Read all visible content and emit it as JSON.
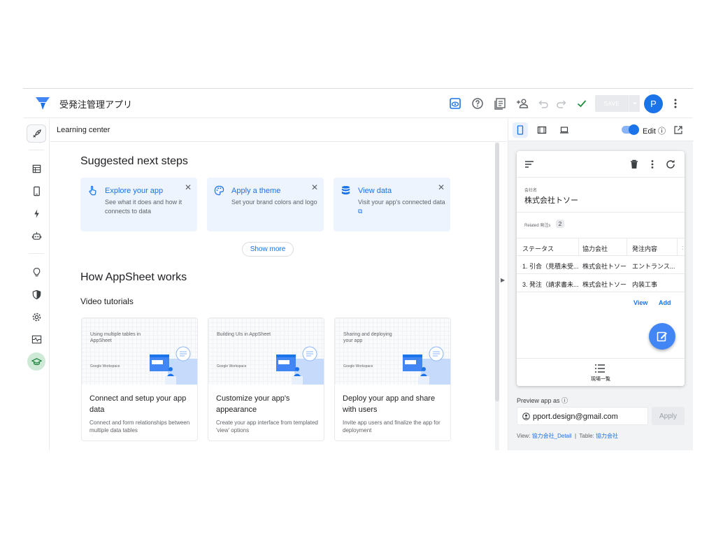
{
  "header": {
    "app_title": "受発注管理アプリ",
    "save_label": "SAVE",
    "avatar_initial": "P",
    "brand_color": "#1a73e8"
  },
  "rail": {
    "items": [
      "rocket-icon",
      "data-icon",
      "phone-icon",
      "automation-icon",
      "bot-icon",
      "lightbulb-icon",
      "shield-icon",
      "settings-icon",
      "monitor-icon",
      "learning-icon"
    ]
  },
  "learning_center": {
    "title": "Learning center",
    "suggested_heading": "Suggested next steps",
    "steps": [
      {
        "title": "Explore your app",
        "desc": "See what it does and how it connects to data",
        "icon": "hand-pointer-icon"
      },
      {
        "title": "Apply a theme",
        "desc": "Set your brand colors and logo",
        "icon": "palette-icon"
      },
      {
        "title": "View data",
        "desc": "Visit your app's connected data",
        "icon": "database-icon"
      }
    ],
    "show_more": "Show more",
    "how_heading": "How AppSheet works",
    "video_heading": "Video tutorials",
    "videos": [
      {
        "thumb_title": "Using multiple tables in AppSheet",
        "brand": "Google Workspace",
        "title": "Connect and setup your app data",
        "desc": "Connect and form relationships between multiple data tables"
      },
      {
        "thumb_title": "Building UIs in AppSheet",
        "brand": "Google Workspace",
        "title": "Customize your app's appearance",
        "desc": "Create your app interface from templated 'view' options"
      },
      {
        "thumb_title": "Sharing and deploying your app",
        "brand": "Google Workspace",
        "title": "Deploy your app and share with users",
        "desc": "Invite app users and finalize the app for deployment"
      }
    ]
  },
  "preview": {
    "edit_label": "Edit",
    "field_label": "会社名",
    "field_value": "株式会社トソー",
    "related_label": "Related 発注s",
    "related_count": "2",
    "table": {
      "headers": [
        "ステータス",
        "協力会社",
        "発注内容"
      ],
      "rows": [
        [
          "1. 引合（見積未受...",
          "株式会社トソー",
          "エントランス..."
        ],
        [
          "3. 発注（請求書未...",
          "株式会社トソー",
          "内装工事"
        ]
      ]
    },
    "view_link": "View",
    "add_link": "Add",
    "bottom_nav_label": "現場一覧",
    "preview_as_label": "Preview app as",
    "email": "pport.design@gmail.com",
    "apply_label": "Apply",
    "view_prefix": "View:",
    "view_name": "協力会社_Detail",
    "table_prefix": "Table:",
    "table_name": "協力会社"
  }
}
